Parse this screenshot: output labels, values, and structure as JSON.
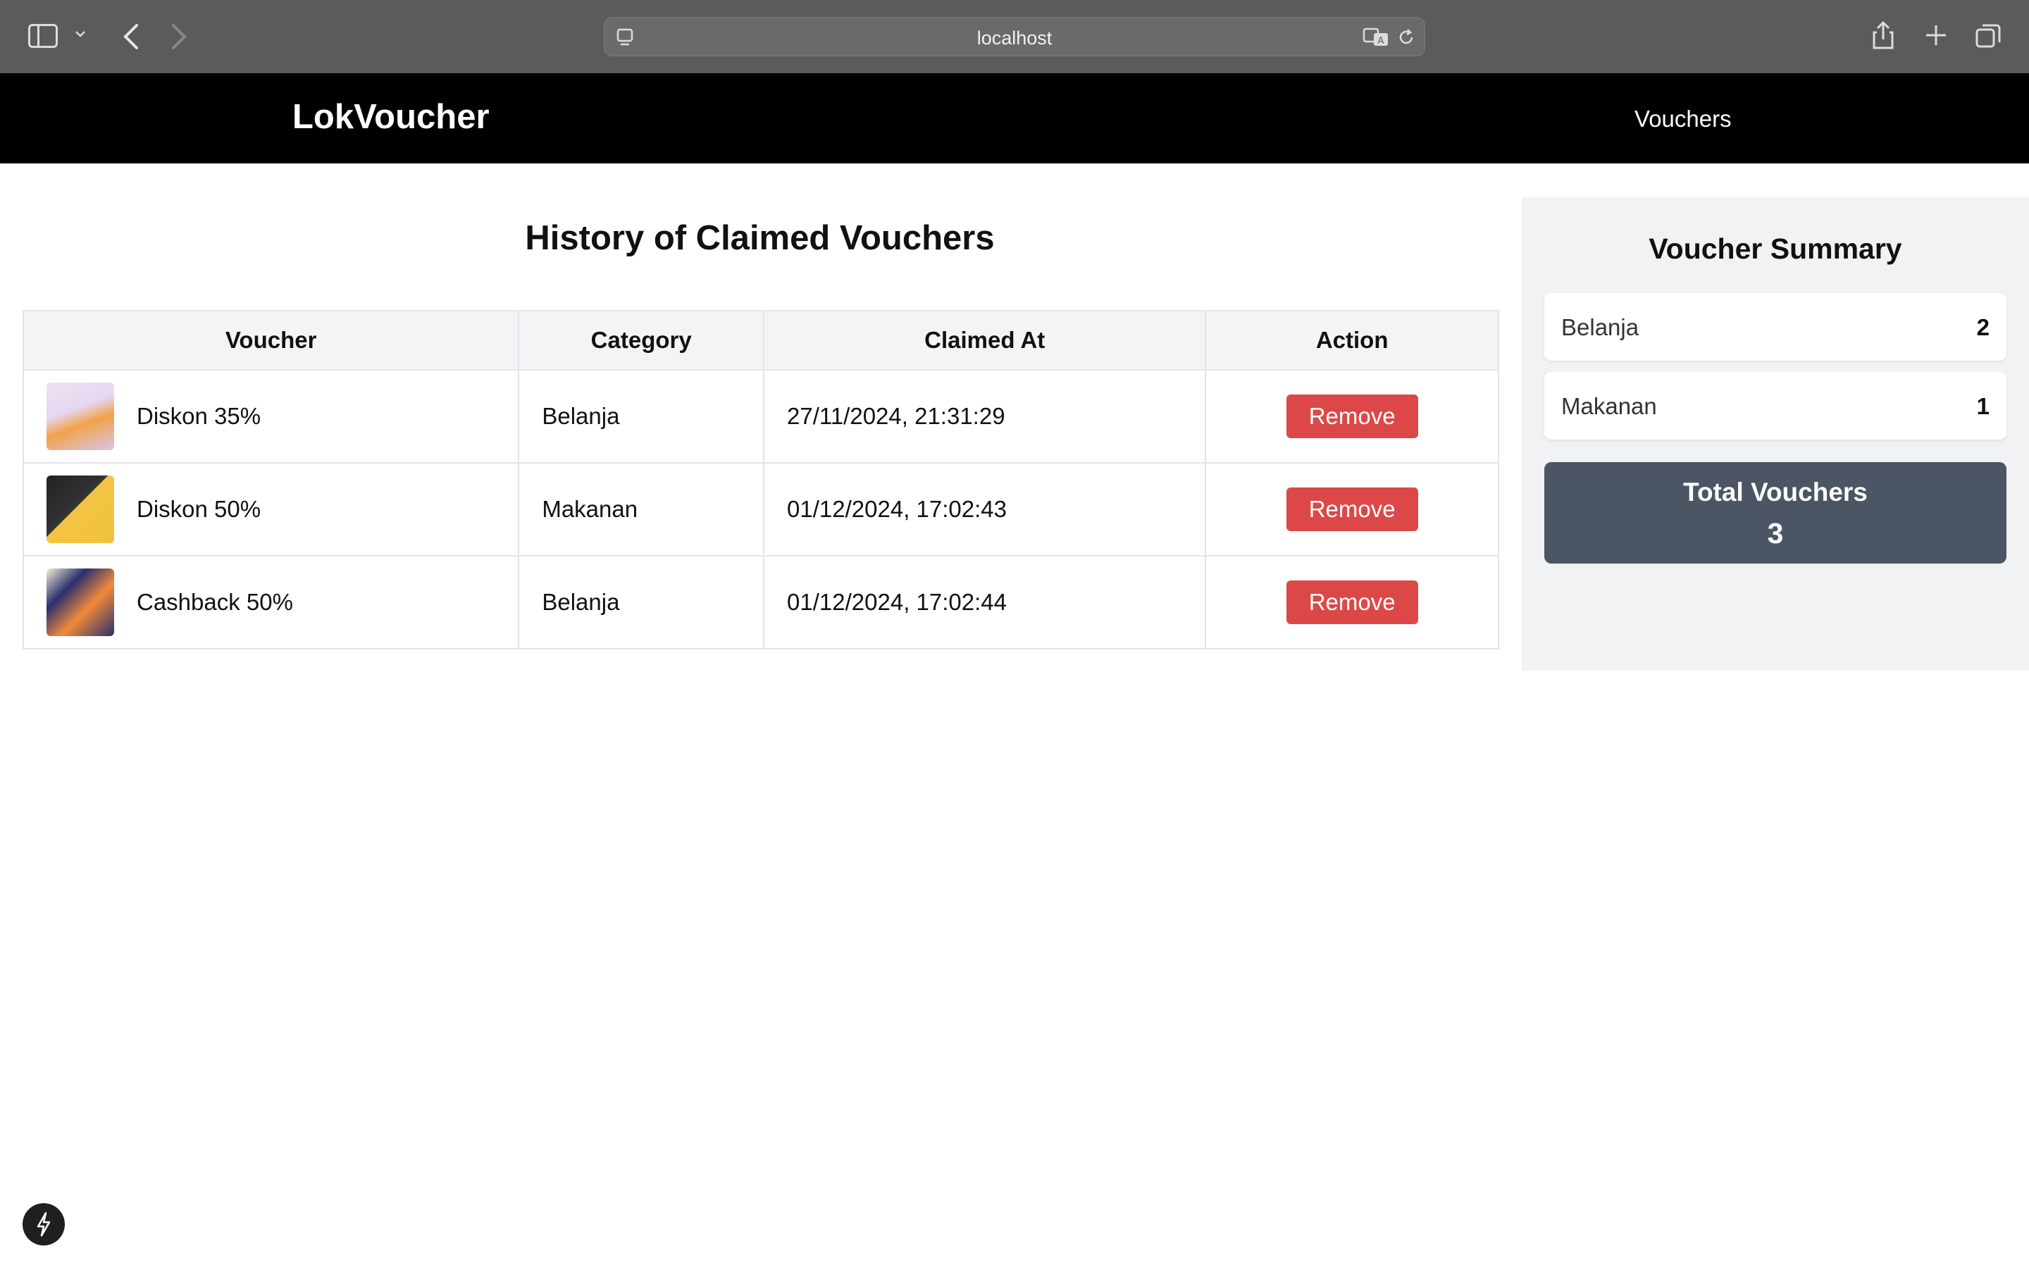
{
  "browser": {
    "url": "localhost"
  },
  "app": {
    "brand": "LokVoucher",
    "nav": [
      {
        "label": "Vouchers"
      }
    ]
  },
  "main": {
    "title": "History of Claimed Vouchers",
    "table": {
      "headers": [
        "Voucher",
        "Category",
        "Claimed At",
        "Action"
      ],
      "rows": [
        {
          "name": "Diskon 35%",
          "category": "Belanja",
          "claimed_at": "27/11/2024, 21:31:29",
          "action": "Remove"
        },
        {
          "name": "Diskon 50%",
          "category": "Makanan",
          "claimed_at": "01/12/2024, 17:02:43",
          "action": "Remove"
        },
        {
          "name": "Cashback 50%",
          "category": "Belanja",
          "claimed_at": "01/12/2024, 17:02:44",
          "action": "Remove"
        }
      ]
    }
  },
  "summary": {
    "title": "Voucher Summary",
    "items": [
      {
        "label": "Belanja",
        "count": "2"
      },
      {
        "label": "Makanan",
        "count": "1"
      }
    ],
    "total_label": "Total Vouchers",
    "total_value": "3"
  },
  "colors": {
    "accent_remove": "#dc4848",
    "appbar": "#000000",
    "total_box": "#4b5563"
  }
}
